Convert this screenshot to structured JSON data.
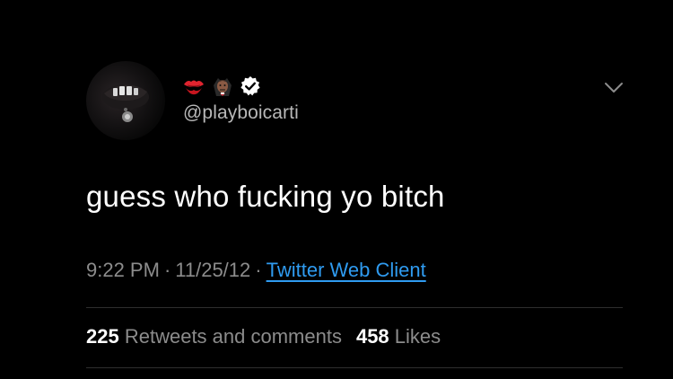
{
  "tweet": {
    "avatar": "profile-avatar",
    "display_name_emojis": [
      "kiss-mark-emoji",
      "vampire-emoji"
    ],
    "verified": "verified-badge-icon",
    "handle": "@playboicarti",
    "text": "guess who fucking yo bitch",
    "time": "9:22 PM",
    "separator": "·",
    "date": "11/25/12",
    "client": "Twitter Web Client",
    "menu_icon": "chevron-down-icon",
    "stats": {
      "retweets_count": "225",
      "retweets_label": "Retweets and comments",
      "likes_count": "458",
      "likes_label": "Likes"
    }
  },
  "colors": {
    "background": "#000000",
    "text_primary": "#ffffff",
    "text_secondary": "#8c8c8c",
    "link": "#2f9bf0",
    "divider": "#2e2e2e"
  }
}
